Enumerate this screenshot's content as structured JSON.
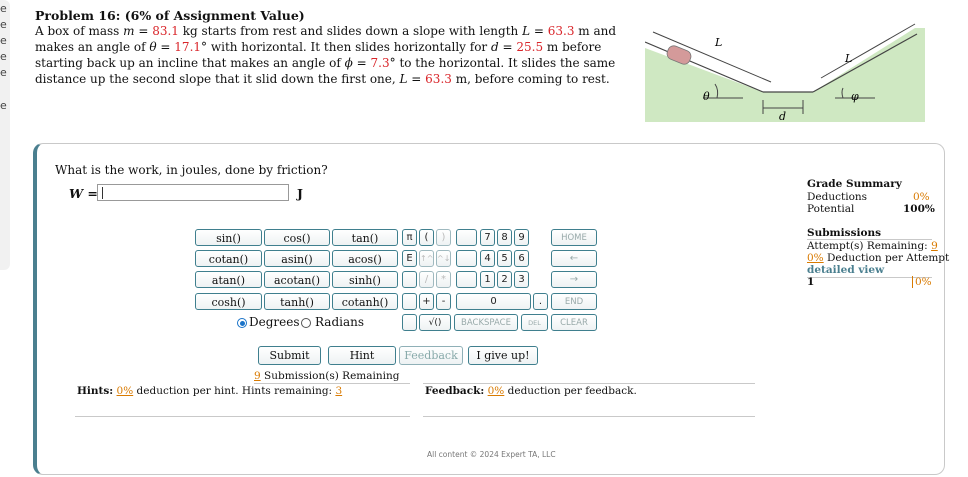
{
  "edge": {
    "marks": [
      "e",
      "e",
      "e",
      "e",
      "e",
      "e"
    ]
  },
  "problem": {
    "title": "Problem 16: (6% of Assignment Value)",
    "mass": "83.1",
    "L": "63.3",
    "theta": "17.1",
    "d": "25.5",
    "phi": "7.3"
  },
  "figure": {
    "label_L1": "L",
    "label_L2": "L",
    "label_theta": "θ",
    "label_d": "d",
    "label_phi": "φ",
    "colors": {
      "ground": "#cfe8c2",
      "box": "#d49a9a"
    }
  },
  "question": {
    "prompt": "What is the work, in joules, done by friction?",
    "var_label": "W =",
    "unit": "J",
    "input_value": ""
  },
  "keypad": {
    "functions": [
      [
        "sin()",
        "cos()",
        "tan()"
      ],
      [
        "cotan()",
        "asin()",
        "acos()"
      ],
      [
        "atan()",
        "acotan()",
        "sinh()"
      ],
      [
        "cosh()",
        "tanh()",
        "cotanh()"
      ]
    ],
    "symbols": [
      "π",
      "(",
      ")",
      "E",
      "↑^",
      "^↓",
      "/",
      "*",
      "+",
      "-",
      "√()"
    ],
    "digits": [
      "7",
      "8",
      "9",
      "4",
      "5",
      "6",
      "1",
      "2",
      "3",
      "0",
      "."
    ],
    "words": {
      "home": "HOME",
      "left": "←",
      "right": "→",
      "end": "END",
      "backspace": "BACKSPACE",
      "del": "DEL",
      "clear": "CLEAR"
    },
    "angle": {
      "degrees": "Degrees",
      "radians": "Radians",
      "selected": "Degrees"
    }
  },
  "actions": {
    "submit": "Submit",
    "hint": "Hint",
    "feedback": "Feedback",
    "give_up": "I give up!"
  },
  "submissions": {
    "remaining_count": "9",
    "remaining_text": "Submission(s) Remaining"
  },
  "hints": {
    "label": "Hints:",
    "pct": "0%",
    "text": "deduction per hint. Hints remaining:",
    "remaining": "3"
  },
  "feedback": {
    "label": "Feedback:",
    "pct": "0%",
    "text": "deduction per feedback."
  },
  "grade": {
    "title": "Grade Summary",
    "deductions_label": "Deductions",
    "deductions_value": "0%",
    "potential_label": "Potential",
    "potential_value": "100%",
    "submissions_title": "Submissions",
    "attempts_label": "Attempt(s) Remaining:",
    "attempts_value": "9",
    "deduction_pct": "0%",
    "deduction_text": "Deduction per Attempt",
    "detailed_view": "detailed view",
    "row_index": "1",
    "row_value": "0%"
  },
  "footer": "All content © 2024 Expert TA, LLC"
}
